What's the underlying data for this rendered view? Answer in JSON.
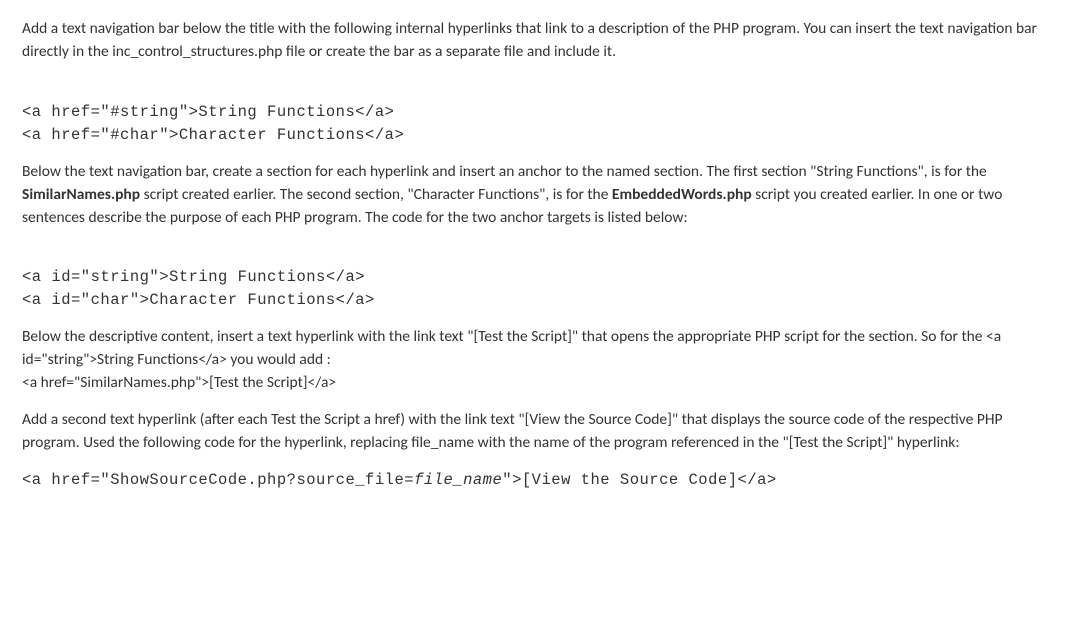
{
  "p1": "Add a text navigation bar below the title with the following internal hyperlinks that link to a description of the PHP program.  You can insert the text navigation bar directly in the inc_control_structures.php file or create the bar as a separate file and include it.",
  "code1_line1": "<a href=\"#string\">String Functions</a>",
  "code1_line2": "<a href=\"#char\">Character Functions</a>",
  "p2_part1": "Below the text navigation bar, create a section for each hyperlink and insert an anchor to the named section.  The first section \"String Functions\", is for the ",
  "p2_bold1": "SimilarNames.php",
  "p2_part2": " script created earlier.  The second section, \"Character Functions\", is for the ",
  "p2_bold2": "EmbeddedWords.php",
  "p2_part3": " script you created earlier.  In one or two sentences describe the purpose of each PHP program.  The code for the two anchor targets is listed below:",
  "code2_line1": "<a id=\"string\">String Functions</a>",
  "code2_line2": "<a id=\"char\">Character Functions</a>",
  "p3_line1": "Below the descriptive content, insert a text hyperlink with the link text \"[Test the Script]\" that opens the appropriate PHP script for the section.  So for the <a id=\"string\">String Functions</a> you would add :",
  "p3_line2": "<a href=\"SimilarNames.php\">[Test the Script]</a>",
  "p4": "Add a second text hyperlink (after each Test the Script a href) with the link text \"[View the Source Code]\" that displays the source code of the respective PHP program.  Used the following code for the hyperlink, replacing file_name with the name of the program referenced in the \"[Test the Script]\" hyperlink:",
  "code3_part1": "<a href=\"ShowSourceCode.php?source_file=",
  "code3_italic": "file_name",
  "code3_part2": "\">[View the Source Code]</a>"
}
